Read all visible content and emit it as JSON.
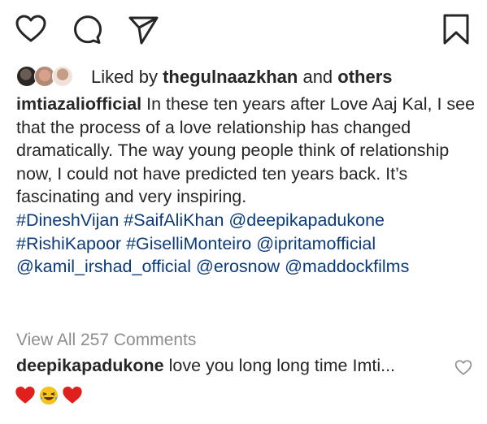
{
  "actions": {
    "like_icon": "heart-outline-icon",
    "comment_icon": "speech-bubble-icon",
    "share_icon": "paper-plane-icon",
    "save_icon": "bookmark-icon"
  },
  "likes": {
    "prefix": "Liked by",
    "user": "thegulnaazkhan",
    "connector": "and",
    "others": "others"
  },
  "caption": {
    "username": "imtiazaliofficial",
    "text": "In these ten years after Love Aaj Kal, I see that the process of a love relationship has changed dramatically. The way young people think of relationship now, I could not have predicted ten years back. It’s fascinating and very inspiring.",
    "tags": [
      "#DineshVijan",
      "#SaifAliKhan",
      "@deepikapadukone",
      "#RishiKapoor",
      "#GiselliMonteiro",
      "@ipritamofficial",
      "@kamil_irshad_official",
      "@erosnow",
      "@maddockfilms"
    ]
  },
  "view_all_comments": "View All 257 Comments",
  "comment": {
    "username": "deepikapadukone",
    "text": "love you long long time Imti...",
    "emojis": [
      "red-heart",
      "laughing-face",
      "red-heart"
    ]
  },
  "colors": {
    "text": "#262626",
    "link": "#0b3b7a",
    "muted": "#8e8e8e",
    "heart": "#e0201c"
  }
}
